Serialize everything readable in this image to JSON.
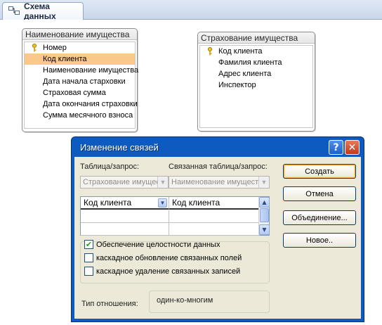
{
  "tab": {
    "title": "Схема данных",
    "icon": "relationships-icon"
  },
  "tables": [
    {
      "title": "Наименование имущества",
      "fields": [
        {
          "name": "Номер",
          "key": true,
          "selected": false
        },
        {
          "name": "Код клиента",
          "key": false,
          "selected": true
        },
        {
          "name": "Наименование имущества",
          "key": false,
          "selected": false
        },
        {
          "name": "Дата начала старховки",
          "key": false,
          "selected": false
        },
        {
          "name": "Страховая сумма",
          "key": false,
          "selected": false
        },
        {
          "name": "Дата окончания страховки",
          "key": false,
          "selected": false
        },
        {
          "name": "Сумма месячного взноса",
          "key": false,
          "selected": false
        }
      ]
    },
    {
      "title": "Страхование имущества",
      "fields": [
        {
          "name": "Код клиента",
          "key": true,
          "selected": false
        },
        {
          "name": "Фамилия клиента",
          "key": false,
          "selected": false
        },
        {
          "name": "Адрес клиента",
          "key": false,
          "selected": false
        },
        {
          "name": "Инспектор",
          "key": false,
          "selected": false
        }
      ]
    }
  ],
  "dialog": {
    "title": "Изменение связей",
    "help_glyph": "?",
    "close_glyph": "✕",
    "table_label": "Таблица/запрос:",
    "related_label": "Связанная таблица/запрос:",
    "table_value": "Страхование имущества",
    "related_value": "Наименование имущества",
    "grid": {
      "left_field": "Код клиента",
      "right_field": "Код клиента"
    },
    "options": {
      "integrity": {
        "label": "Обеспечение целостности данных",
        "checked": true
      },
      "cascade_update": {
        "label": "каскадное обновление связанных полей",
        "checked": false
      },
      "cascade_delete": {
        "label": "каскадное удаление связанных записей",
        "checked": false
      }
    },
    "relation_type_label": "Тип отношения:",
    "relation_type_value": "один-ко-многим",
    "buttons": {
      "create": "Создать",
      "cancel": "Отмена",
      "join": "Объединение...",
      "new": "Новое.."
    }
  },
  "colors": {
    "selected_row": "#fbc88c",
    "dialog_frame": "#0d5ac1",
    "dialog_body": "#ece9d8"
  }
}
